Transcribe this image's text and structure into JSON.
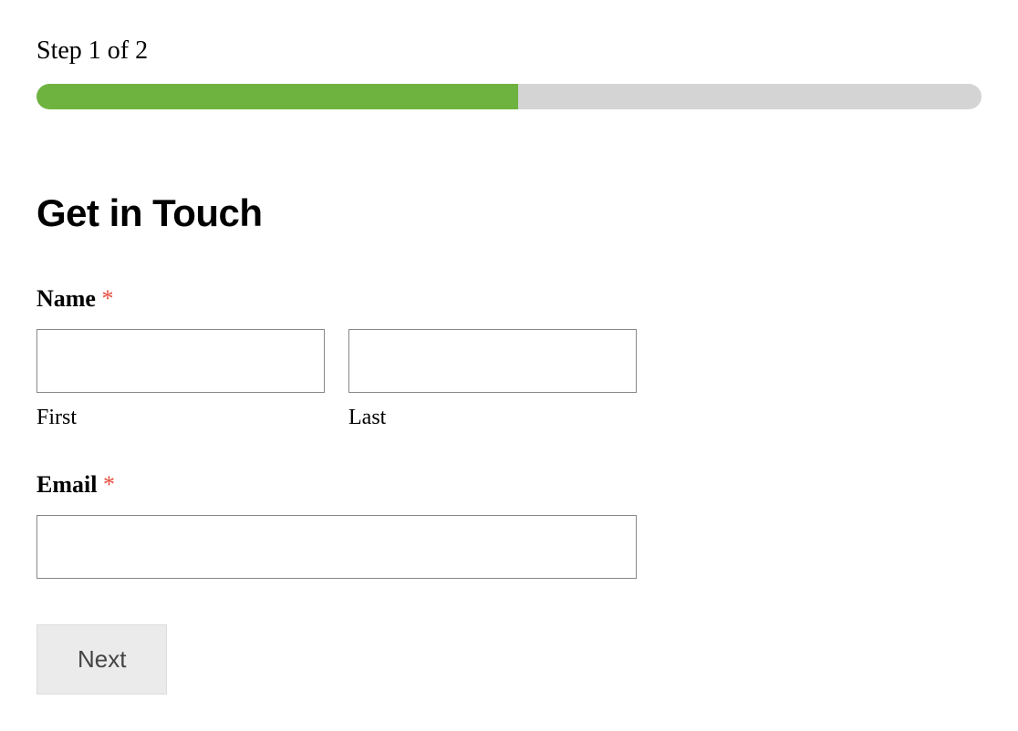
{
  "step": {
    "label": "Step 1 of 2",
    "progress_percent": 51
  },
  "form": {
    "title": "Get in Touch",
    "name": {
      "label": "Name",
      "required_marker": "*",
      "first_sublabel": "First",
      "last_sublabel": "Last",
      "first_value": "",
      "last_value": ""
    },
    "email": {
      "label": "Email",
      "required_marker": "*",
      "value": ""
    },
    "next_button_label": "Next"
  }
}
